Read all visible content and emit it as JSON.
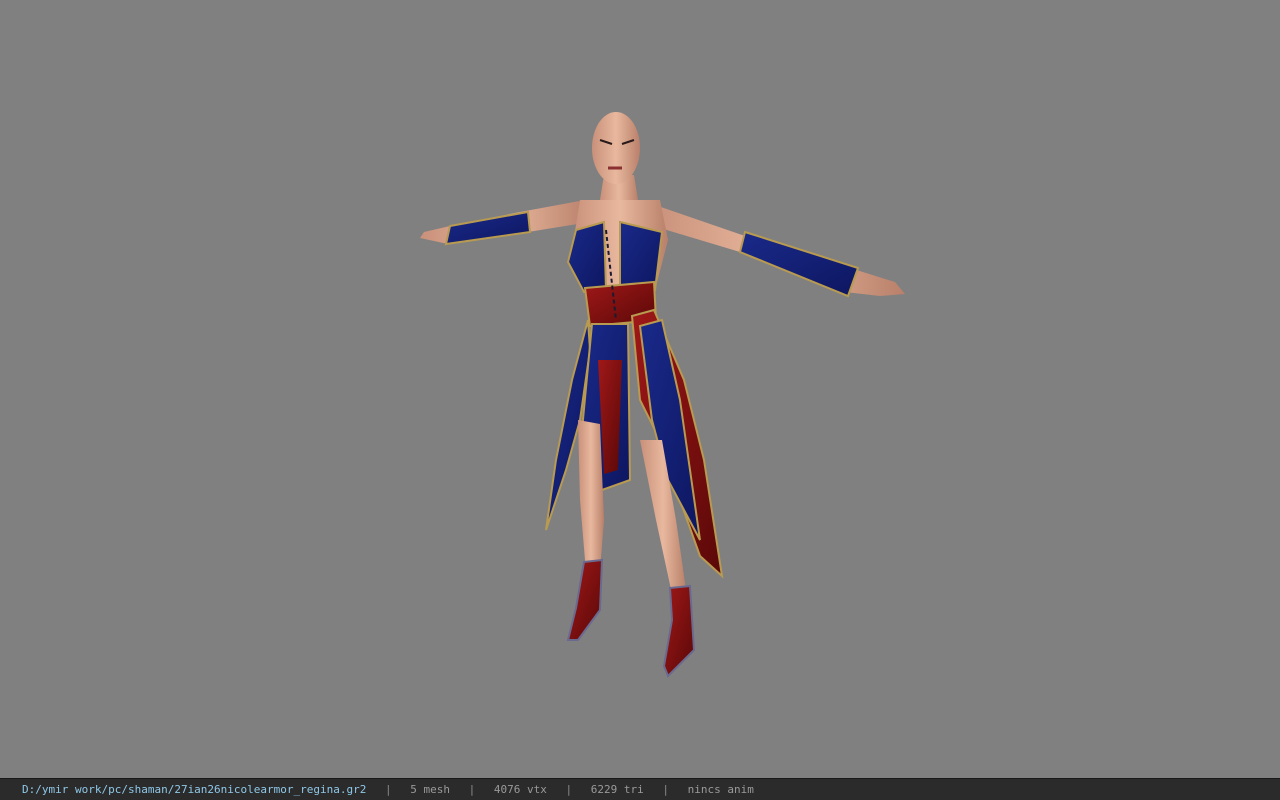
{
  "viewport": {
    "background": "#808080",
    "model_name": "nicolearmor_regina"
  },
  "statusbar": {
    "file_path": "D:/ymir work/pc/shaman/27ian26nicolearmor_regina.gr2",
    "mesh_count": "5 mesh",
    "vertex_count": "4076 vtx",
    "triangle_count": "6229 tri",
    "anim_status": "nincs anim",
    "separator": "|",
    "path_color": "#8ec8e8",
    "text_color": "#9a9a9a"
  }
}
